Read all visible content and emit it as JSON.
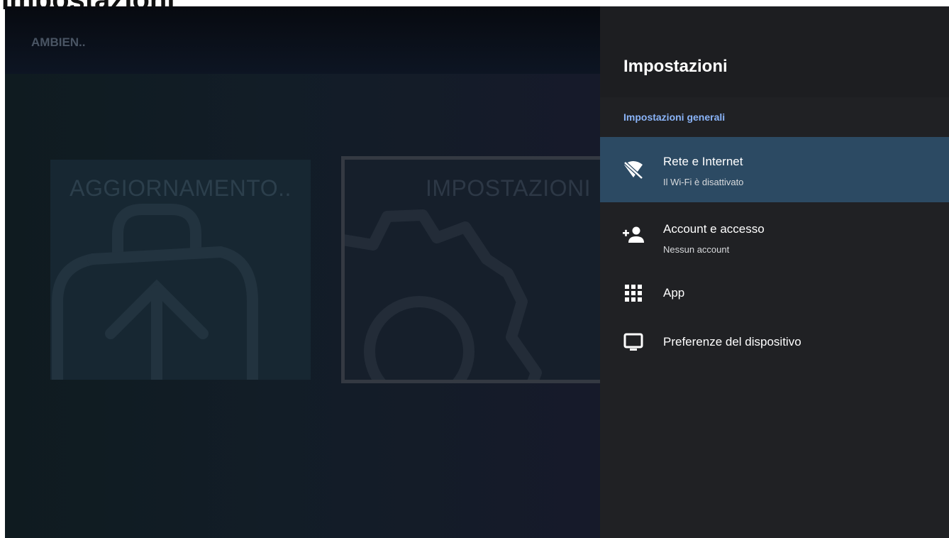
{
  "window": {
    "title": "Impostazioni"
  },
  "background": {
    "header_label": "AMBIEN..",
    "tiles": [
      {
        "label": "AGGIORNAMENTO..",
        "icon": "update-bag-icon"
      },
      {
        "label": "IMPOSTAZIONI",
        "icon": "gear-icon"
      }
    ]
  },
  "panel": {
    "title": "Impostazioni",
    "section": "Impostazioni generali",
    "items": [
      {
        "title": "Rete e Internet",
        "subtitle": "Il Wi-Fi è disattivato",
        "icon": "wifi-off-icon",
        "selected": true
      },
      {
        "title": "Account e accesso",
        "subtitle": "Nessun account",
        "icon": "add-person-icon",
        "selected": false
      },
      {
        "title": "App",
        "subtitle": "",
        "icon": "apps-grid-icon",
        "selected": false
      },
      {
        "title": "Preferenze del dispositivo",
        "subtitle": "",
        "icon": "tv-display-icon",
        "selected": false
      }
    ]
  },
  "colors": {
    "accent": "#8ab4f8",
    "selected_row": "#2c4a63",
    "panel_bg": "#202124"
  }
}
